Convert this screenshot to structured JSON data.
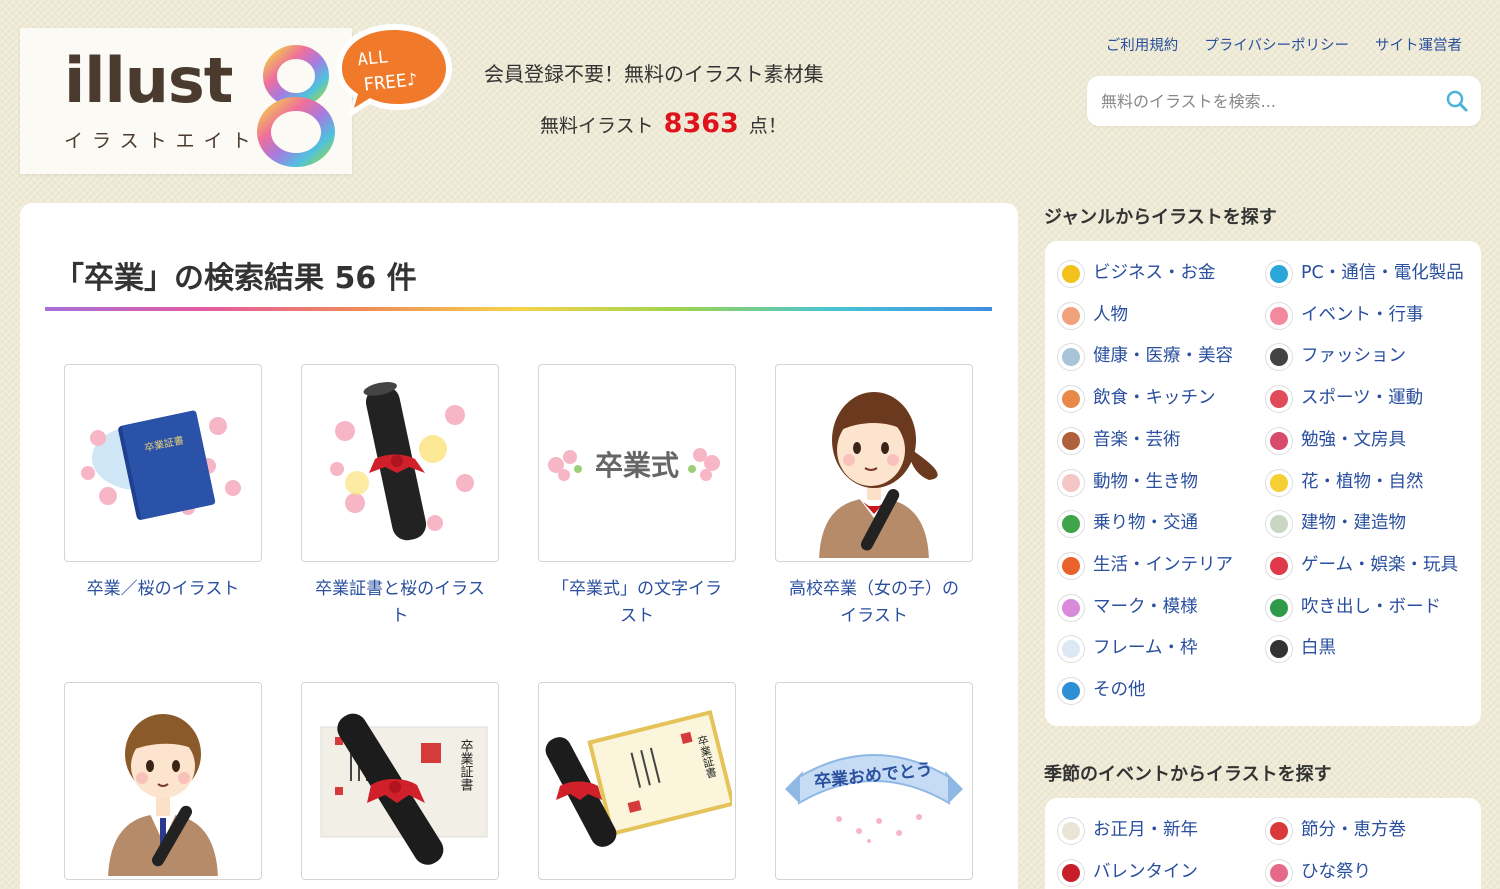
{
  "header": {
    "logo_text": "illust",
    "logo_kana": "イラストエイト",
    "logo_badge_line1": "ALL",
    "logo_badge_line2": "FREE♪",
    "tagline": "会員登録不要！無料のイラスト素材集",
    "count_prefix": "無料イラスト",
    "count_value": "8363",
    "count_suffix": "点！",
    "links": [
      "ご利用規約",
      "プライバシーポリシー",
      "サイト運営者"
    ],
    "search_placeholder": "無料のイラストを検索..."
  },
  "main": {
    "result_title": "「卒業」の検索結果 56 件",
    "cards": [
      {
        "title": "卒業／桜のイラスト"
      },
      {
        "title": "卒業証書と桜のイラスト"
      },
      {
        "title": "「卒業式」の文字イラスト",
        "image_text": "卒業式"
      },
      {
        "title": "高校卒業（女の子）のイラスト"
      },
      {
        "title": ""
      },
      {
        "title": ""
      },
      {
        "title": ""
      },
      {
        "title": "",
        "image_text": "卒業おめでとう"
      }
    ],
    "certificate_text": "卒業証書",
    "certificate_small": "卒業証書"
  },
  "sidebar": {
    "genre_heading": "ジャンルからイラストを探す",
    "genres": [
      {
        "label": "ビジネス・お金",
        "icon": "coins-icon",
        "color": "#f2c21b"
      },
      {
        "label": "PC・通信・電化製品",
        "icon": "monitor-icon",
        "color": "#2aa7d9"
      },
      {
        "label": "人物",
        "icon": "people-icon",
        "color": "#f0a27a"
      },
      {
        "label": "イベント・行事",
        "icon": "flower-event-icon",
        "color": "#f08a9c"
      },
      {
        "label": "健康・医療・美容",
        "icon": "doctor-icon",
        "color": "#a8c4d8"
      },
      {
        "label": "ファッション",
        "icon": "lipstick-icon",
        "color": "#444444"
      },
      {
        "label": "飲食・キッチン",
        "icon": "pudding-icon",
        "color": "#e8894a"
      },
      {
        "label": "スポーツ・運動",
        "icon": "racket-icon",
        "color": "#e04b5a"
      },
      {
        "label": "音楽・芸術",
        "icon": "violin-icon",
        "color": "#b0603a"
      },
      {
        "label": "勉強・文房具",
        "icon": "pencils-icon",
        "color": "#d94b6a"
      },
      {
        "label": "動物・生き物",
        "icon": "rabbit-icon",
        "color": "#f5c6c6"
      },
      {
        "label": "花・植物・自然",
        "icon": "tulip-icon",
        "color": "#f6cf32"
      },
      {
        "label": "乗り物・交通",
        "icon": "car-icon",
        "color": "#3fa44a"
      },
      {
        "label": "建物・建造物",
        "icon": "building-icon",
        "color": "#c9d6c4"
      },
      {
        "label": "生活・インテリア",
        "icon": "kettle-icon",
        "color": "#e8622a"
      },
      {
        "label": "ゲーム・娯楽・玩具",
        "icon": "card-icon",
        "color": "#e03a4a"
      },
      {
        "label": "マーク・模様",
        "icon": "mark-icon",
        "color": "#d98ad9"
      },
      {
        "label": "吹き出し・ボード",
        "icon": "speech-icon",
        "color": "#2f9a4a"
      },
      {
        "label": "フレーム・枠",
        "icon": "frame-icon",
        "color": "#dde8f5"
      },
      {
        "label": "白黒",
        "icon": "checker-flag-icon",
        "color": "#333333"
      },
      {
        "label": "その他",
        "icon": "globe-icon",
        "color": "#2f8fd4"
      }
    ],
    "season_heading": "季節のイベントからイラストを探す",
    "seasons": [
      {
        "label": "お正月・新年",
        "icon": "kagami-mochi-icon",
        "color": "#e9e4d4"
      },
      {
        "label": "節分・恵方巻",
        "icon": "oni-icon",
        "color": "#d83a3a"
      },
      {
        "label": "バレンタイン",
        "icon": "heart-icon",
        "color": "#c81d2a"
      },
      {
        "label": "ひな祭り",
        "icon": "hina-doll-icon",
        "color": "#e56a8a"
      }
    ]
  }
}
